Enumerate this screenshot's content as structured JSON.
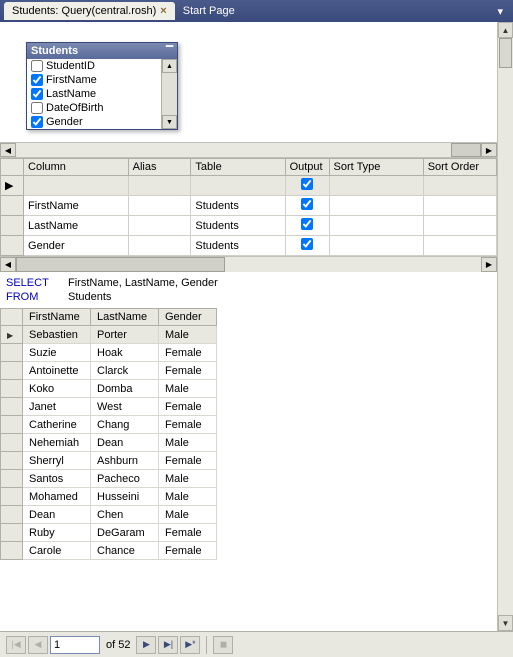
{
  "tabs": {
    "active": "Students: Query(central.rosh)",
    "inactive": "Start Page"
  },
  "tableBox": {
    "title": "Students",
    "fields": [
      {
        "name": "StudentID",
        "checked": false
      },
      {
        "name": "FirstName",
        "checked": true
      },
      {
        "name": "LastName",
        "checked": true
      },
      {
        "name": "DateOfBirth",
        "checked": false
      },
      {
        "name": "Gender",
        "checked": true
      }
    ]
  },
  "criteria": {
    "headers": {
      "column": "Column",
      "alias": "Alias",
      "table": "Table",
      "output": "Output",
      "sortType": "Sort Type",
      "sortOrder": "Sort Order"
    },
    "rows": [
      {
        "column": "",
        "alias": "",
        "table": "",
        "output": true,
        "sortType": "",
        "sortOrder": ""
      },
      {
        "column": "FirstName",
        "alias": "",
        "table": "Students",
        "output": true,
        "sortType": "",
        "sortOrder": ""
      },
      {
        "column": "LastName",
        "alias": "",
        "table": "Students",
        "output": true,
        "sortType": "",
        "sortOrder": ""
      },
      {
        "column": "Gender",
        "alias": "",
        "table": "Students",
        "output": true,
        "sortType": "",
        "sortOrder": ""
      }
    ]
  },
  "sql": {
    "selectKw": "SELECT",
    "selectCols": "FirstName, LastName, Gender",
    "fromKw": "FROM",
    "fromTbl": "Students"
  },
  "results": {
    "headers": {
      "first": "FirstName",
      "last": "LastName",
      "gender": "Gender"
    },
    "rows": [
      {
        "first": "Sebastien",
        "last": "Porter",
        "gender": "Male"
      },
      {
        "first": "Suzie",
        "last": "Hoak",
        "gender": "Female"
      },
      {
        "first": "Antoinette",
        "last": "Clarck",
        "gender": "Female"
      },
      {
        "first": "Koko",
        "last": "Domba",
        "gender": "Male"
      },
      {
        "first": "Janet",
        "last": "West",
        "gender": "Female"
      },
      {
        "first": "Catherine",
        "last": "Chang",
        "gender": "Female"
      },
      {
        "first": "Nehemiah",
        "last": "Dean",
        "gender": "Male"
      },
      {
        "first": "Sherryl",
        "last": "Ashburn",
        "gender": "Female"
      },
      {
        "first": "Santos",
        "last": "Pacheco",
        "gender": "Male"
      },
      {
        "first": "Mohamed",
        "last": "Husseini",
        "gender": "Male"
      },
      {
        "first": "Dean",
        "last": "Chen",
        "gender": "Male"
      },
      {
        "first": "Ruby",
        "last": "DeGaram",
        "gender": "Female"
      },
      {
        "first": "Carole",
        "last": "Chance",
        "gender": "Female"
      }
    ]
  },
  "nav": {
    "current": "1",
    "ofLabel": "of 52"
  }
}
